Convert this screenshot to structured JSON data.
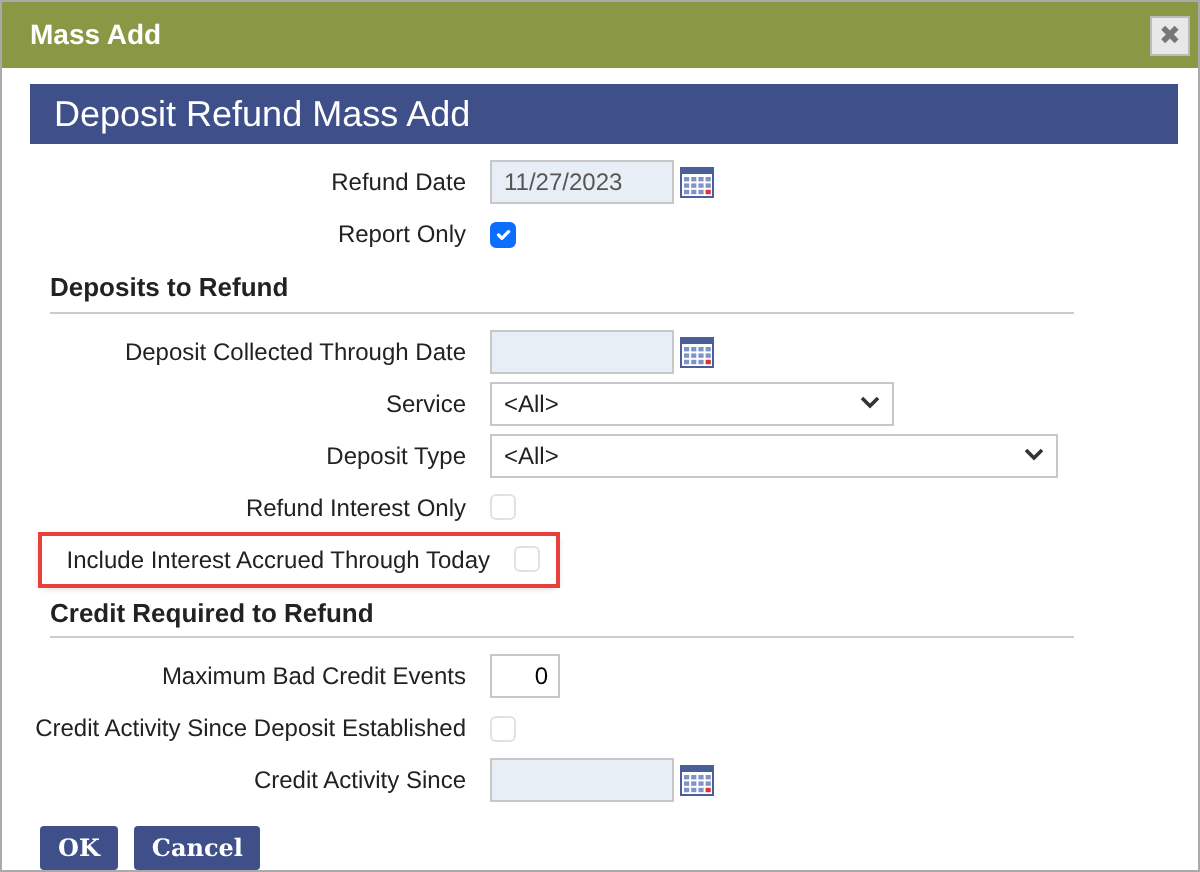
{
  "window": {
    "title": "Mass Add",
    "close": "✖"
  },
  "header": "Deposit Refund Mass Add",
  "top_fields": [
    {
      "kind": "date",
      "label": "Refund Date",
      "value": "11/27/2023"
    },
    {
      "kind": "checkbox",
      "label": "Report Only",
      "checked": true
    }
  ],
  "sections": [
    {
      "title": "Deposits to Refund",
      "fields": [
        {
          "kind": "date",
          "label": "Deposit Collected Through Date"
        },
        {
          "kind": "select",
          "label": "Service",
          "value": "<All>",
          "wide": false
        },
        {
          "kind": "select",
          "label": "Deposit Type",
          "value": "<All>",
          "wide": true
        },
        {
          "kind": "checkbox",
          "label": "Refund Interest Only",
          "checked": false
        },
        {
          "kind": "checkbox",
          "label": "Include Interest Accrued Through Today",
          "checked": false,
          "highlighted": true
        }
      ]
    },
    {
      "title": "Credit Required to Refund",
      "fields": [
        {
          "kind": "number",
          "label": "Maximum Bad Credit Events",
          "value": "0"
        },
        {
          "kind": "checkbox",
          "label": "Credit Activity Since Deposit Established",
          "checked": false
        },
        {
          "kind": "date",
          "label": "Credit Activity Since"
        }
      ]
    }
  ],
  "buttons": [
    "OK",
    "Cancel"
  ]
}
